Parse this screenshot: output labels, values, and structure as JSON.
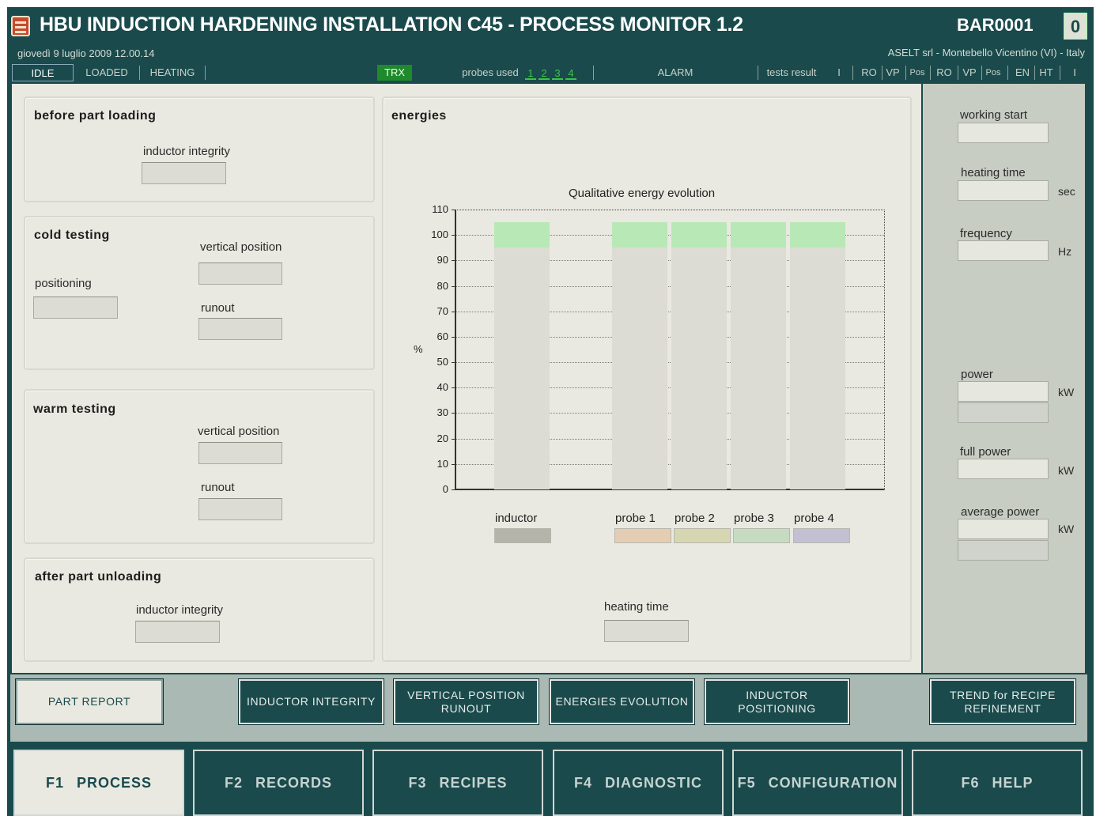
{
  "header": {
    "title": "HBU INDUCTION HARDENING INSTALLATION C45 - PROCESS MONITOR 1.2",
    "machine_id": "BAR0001",
    "counter": "0",
    "datetime": "giovedì 9 luglio 2009 12.00.14",
    "company": "ASELT srl  - Montebello Vicentino (VI) - Italy"
  },
  "status_bar": {
    "states": [
      "IDLE",
      "LOADED",
      "HEATING"
    ],
    "active_state": "IDLE",
    "trx": "TRX",
    "probes_used_label": "probes used",
    "probes": [
      "1",
      "2",
      "3",
      "4"
    ],
    "alarm": "ALARM",
    "tests_result_label": "tests result",
    "result_codes": [
      "I",
      "RO",
      "VP",
      "Pos",
      "RO",
      "VP",
      "Pos",
      "EN",
      "HT",
      "I"
    ],
    "colors": {
      "trx_active": "#1f8a2c",
      "probe_active": "#3dc24a"
    }
  },
  "before_part_loading": {
    "title": "before part loading",
    "inductor_integrity_label": "inductor integrity",
    "inductor_integrity_value": ""
  },
  "cold_testing": {
    "title": "cold testing",
    "positioning_label": "positioning",
    "positioning_value": "",
    "vertical_position_label": "vertical position",
    "vertical_position_value": "",
    "runout_label": "runout",
    "runout_value": ""
  },
  "warm_testing": {
    "title": "warm testing",
    "vertical_position_label": "vertical position",
    "vertical_position_value": "",
    "runout_label": "runout",
    "runout_value": ""
  },
  "after_part_unloading": {
    "title": "after part unloading",
    "inductor_integrity_label": "inductor integrity",
    "inductor_integrity_value": ""
  },
  "energies": {
    "title": "energies",
    "heating_time_label": "heating time",
    "heating_time_value": ""
  },
  "chart_data": {
    "type": "bar",
    "title": "Qualitative energy evolution",
    "xlabel": "",
    "ylabel": "%",
    "ylim": [
      0,
      110
    ],
    "yticks": [
      0,
      10,
      20,
      30,
      40,
      50,
      60,
      70,
      80,
      90,
      100,
      110
    ],
    "grid": true,
    "categories": [
      "inductor",
      "probe 1",
      "probe 2",
      "probe 3",
      "probe 4"
    ],
    "values": [
      100,
      100,
      100,
      100,
      100
    ],
    "legend": [
      {
        "name": "inductor",
        "color": "#b5b4ab"
      },
      {
        "name": "probe 1",
        "color": "#e5cdb3"
      },
      {
        "name": "probe 2",
        "color": "#d6d6b0"
      },
      {
        "name": "probe 3",
        "color": "#c6dcc2"
      },
      {
        "name": "probe 4",
        "color": "#c2c0d2"
      }
    ]
  },
  "right_panel": {
    "working_start_label": "working start",
    "working_start_value": "",
    "heating_time_label": "heating time",
    "heating_time_value": "",
    "heating_time_unit": "sec",
    "frequency_label": "frequency",
    "frequency_value": "",
    "frequency_unit": "Hz",
    "power_label": "power",
    "power_value": "",
    "power_unit": "kW",
    "full_power_label": "full power",
    "full_power_value": "",
    "full_power_unit": "kW",
    "average_power_label": "average power",
    "average_power_value": "",
    "average_power_unit": "kW"
  },
  "actions": {
    "part_report": "PART REPORT",
    "inductor_integrity": "INDUCTOR INTEGRITY",
    "vertical_position_line1": "VERTICAL POSITION",
    "vertical_position_line2": "RUNOUT",
    "energies_evolution": "ENERGIES  EVOLUTION",
    "inductor_positioning": "INDUCTOR POSITIONING",
    "trend_line1": "TREND for RECIPE",
    "trend_line2": "REFINEMENT"
  },
  "function_keys": [
    {
      "label": "F1   PROCESS",
      "active": true
    },
    {
      "label": "F2   RECORDS",
      "active": false
    },
    {
      "label": "F3   RECIPES",
      "active": false
    },
    {
      "label": "F4   DIAGNOSTIC",
      "active": false
    },
    {
      "label": "F5   CONFIGURATION",
      "active": false
    },
    {
      "label": "F6   HELP",
      "active": false
    }
  ]
}
